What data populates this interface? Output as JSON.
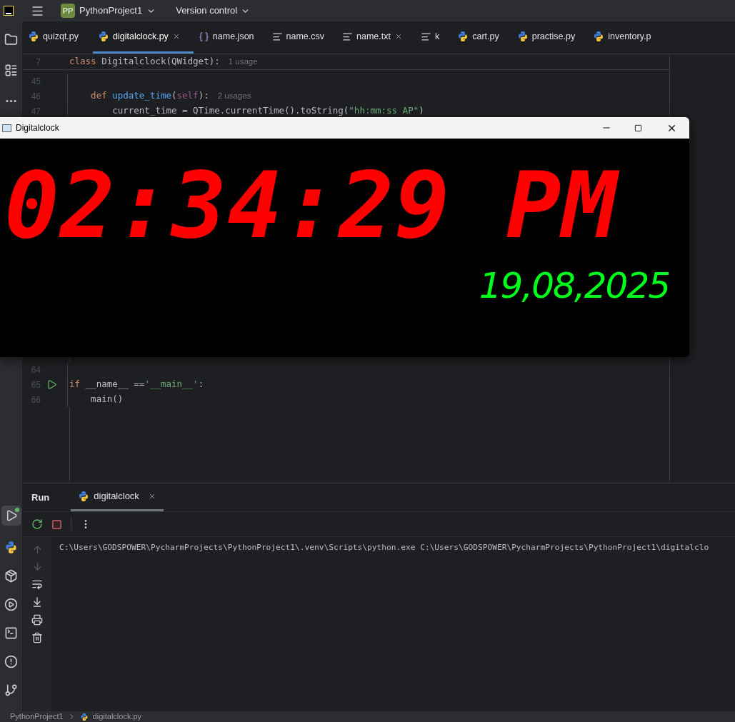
{
  "title_bar": {
    "project_badge": "PP",
    "project": "PythonProject1",
    "vcs": "Version control"
  },
  "editor_tabs": [
    {
      "label": "quizqt.py",
      "kind": "python",
      "selected": false,
      "close_visible": false
    },
    {
      "label": "digitalclock.py",
      "kind": "python",
      "selected": true,
      "close_visible": true
    },
    {
      "label": "name.json",
      "kind": "json",
      "selected": false,
      "close_visible": false
    },
    {
      "label": "name.csv",
      "kind": "text",
      "selected": false,
      "close_visible": false
    },
    {
      "label": "name.txt",
      "kind": "text",
      "selected": false,
      "close_visible": true
    },
    {
      "label": "k",
      "kind": "text",
      "selected": false,
      "close_visible": false
    },
    {
      "label": "cart.py",
      "kind": "python",
      "selected": false,
      "close_visible": false
    },
    {
      "label": "practise.py",
      "kind": "python",
      "selected": false,
      "close_visible": false
    },
    {
      "label": "inventory.p",
      "kind": "python",
      "selected": false,
      "close_visible": false
    }
  ],
  "sticky_line": {
    "number": "7",
    "tokens": [
      {
        "kind": "keyword",
        "text": "class "
      },
      {
        "kind": "plain",
        "text": "Digitalclock(QWidget):"
      }
    ],
    "hint": "1 usage"
  },
  "code_lines_top": [
    {
      "number": "45",
      "run": false
    },
    {
      "number": "46",
      "run": false,
      "tokens": [
        {
          "kind": "keyword",
          "text": "    def "
        },
        {
          "kind": "function",
          "text": "update_time"
        },
        {
          "kind": "plain",
          "text": "("
        },
        {
          "kind": "self",
          "text": "self"
        },
        {
          "kind": "plain",
          "text": "):"
        }
      ],
      "hint": "2 usages"
    },
    {
      "number": "47",
      "run": false,
      "tokens": [
        {
          "kind": "plain",
          "text": "        current_time = QTime.currentTime().toString("
        },
        {
          "kind": "string",
          "text": "\"hh:mm:ss AP\""
        },
        {
          "kind": "plain",
          "text": ")"
        }
      ]
    }
  ],
  "code_lines_bottom": [
    {
      "number": "64",
      "run": false
    },
    {
      "number": "65",
      "run": true,
      "tokens": [
        {
          "kind": "keyword",
          "text": "if "
        },
        {
          "kind": "plain",
          "text": "__name__ =="
        },
        {
          "kind": "string",
          "text": "'__main__'"
        },
        {
          "kind": "plain",
          "text": ":"
        }
      ]
    },
    {
      "number": "66",
      "run": false,
      "tokens": [
        {
          "kind": "plain",
          "text": "    main()"
        }
      ]
    }
  ],
  "clock_window": {
    "title": "Digitalclock",
    "time": "02:34:29 PM",
    "date": "19,08,2025"
  },
  "run_panel": {
    "title": "Run",
    "tabs": [
      {
        "label": "digitalclock",
        "selected": true
      }
    ],
    "output": "C:\\Users\\GODSPOWER\\PycharmProjects\\PythonProject1\\.venv\\Scripts\\python.exe C:\\Users\\GODSPOWER\\PycharmProjects\\PythonProject1\\digitalclo"
  },
  "status_bar": {
    "project": "PythonProject1",
    "file": "digitalclock.py"
  }
}
